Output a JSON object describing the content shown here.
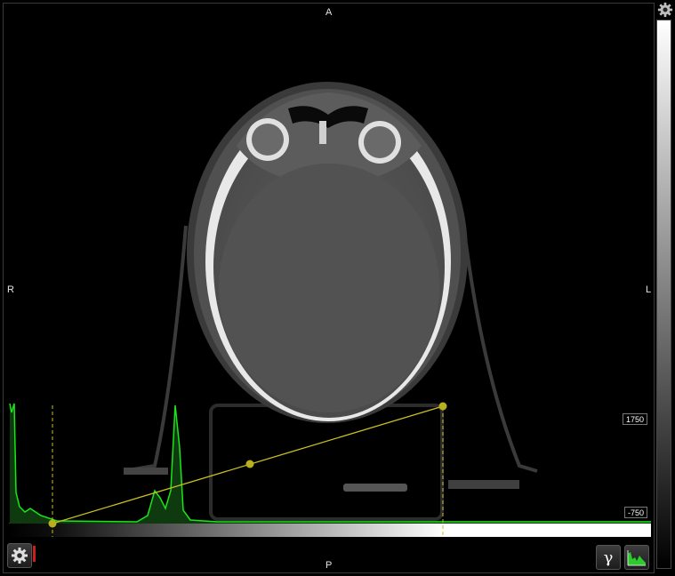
{
  "orientation": {
    "top": "A",
    "bottom": "P",
    "left": "R",
    "right": "L"
  },
  "window_levels": {
    "max": "1750",
    "min": "-750"
  },
  "icons": {
    "settings": "gear-icon",
    "viewport_settings": "gear-icon",
    "gamma": "gamma-icon",
    "histogram": "histogram-icon"
  },
  "toolbar": {
    "gamma_glyph": "γ"
  },
  "colors": {
    "histogram": "#19e619",
    "transfer_curve": "#c8c020",
    "control_point": "#b8b020"
  }
}
